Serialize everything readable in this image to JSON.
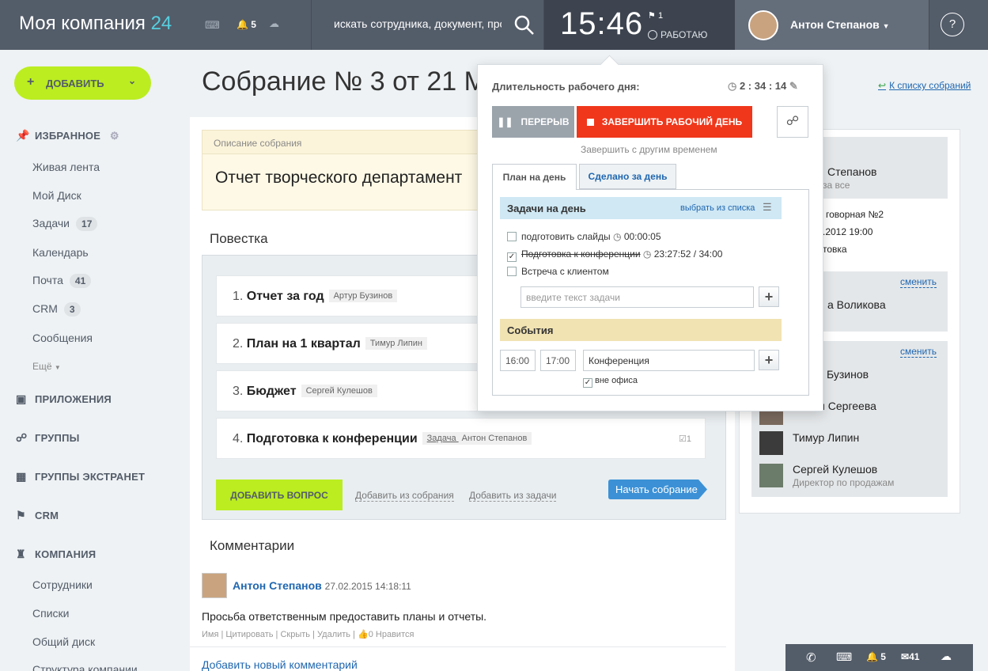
{
  "header": {
    "logo_text": "Моя компания",
    "logo_num": "24",
    "notif_count": "5",
    "search_placeholder": "искать сотрудника, документ, прочее...",
    "clock": "15:46",
    "flag_count": "1",
    "status": "РАБОТАЮ",
    "user_name": "Антон Степанов",
    "help": "?"
  },
  "left": {
    "add_label": "ДОБАВИТЬ",
    "favorites": "ИЗБРАННОЕ",
    "items": [
      {
        "label": "Живая лента",
        "count": ""
      },
      {
        "label": "Мой Диск",
        "count": ""
      },
      {
        "label": "Задачи",
        "count": "17"
      },
      {
        "label": "Календарь",
        "count": ""
      },
      {
        "label": "Почта",
        "count": "41"
      },
      {
        "label": "CRM",
        "count": "3"
      },
      {
        "label": "Сообщения",
        "count": ""
      }
    ],
    "more": "Ещё",
    "sections": [
      "ПРИЛОЖЕНИЯ",
      "ГРУППЫ",
      "ГРУППЫ ЭКСТРАНЕТ",
      "CRM",
      "КОМПАНИЯ"
    ],
    "company_items": [
      "Сотрудники",
      "Списки",
      "Общий диск",
      "Структура компании"
    ]
  },
  "main": {
    "title": "Собрание № 3 от 21 М",
    "back_link": "К списку собраний",
    "desc_label": "Описание собрания",
    "desc_text": "Отчет творческого департамент",
    "agenda_title": "Повестка",
    "agenda": [
      {
        "num": "1.",
        "title": "Отчет за год",
        "tag1": "",
        "tag2": "Артур Бузинов"
      },
      {
        "num": "2.",
        "title": "План на 1 квартал",
        "tag1": "",
        "tag2": "Тимур Липин"
      },
      {
        "num": "3.",
        "title": "Бюджет",
        "tag1": "",
        "tag2": "Сергей Кулешов"
      },
      {
        "num": "4.",
        "title": "Подготовка к конференции",
        "tag1": "Задача",
        "tag2": "Антон Степанов"
      }
    ],
    "task_count": "1",
    "add_question": "ДОБАВИТЬ ВОПРОС",
    "add_from_meeting": "Добавить из собрания",
    "add_from_task": "Добавить из задачи",
    "start_meeting": "Начать собрание",
    "comments_title": "Комментарии",
    "comment_author": "Антон Степанов",
    "comment_date": "27.02.2015 14:18:11",
    "comment_text": "Просьба ответственным предоставить планы и отчеты.",
    "comment_actions": [
      "Имя",
      "Цитировать",
      "Скрыть",
      "Удалить"
    ],
    "like_count": "0",
    "like_label": "Нравится",
    "add_comment": "Добавить новый комментарий"
  },
  "right": {
    "owner": "Степанов",
    "owner_sub": "за все",
    "place": "говорная №2",
    "date": ".2012 19:00",
    "type": "товка",
    "change1": "сменить",
    "secretary": "а Воликова",
    "change2": "сменить",
    "members": [
      {
        "name": "Бузинов",
        "sub": ""
      },
      {
        "name": "ья Сергеева",
        "sub": ""
      },
      {
        "name": "Тимур Липин",
        "sub": ""
      },
      {
        "name": "Сергей Кулешов",
        "sub": "Директор по продажам"
      }
    ]
  },
  "popup": {
    "duration_label": "Длительность рабочего дня:",
    "duration": "2 : 34 : 14",
    "pause": "ПЕРЕРЫВ",
    "finish": "ЗАВЕРШИТЬ РАБОЧИЙ ДЕНЬ",
    "finish_other": "Завершить с другим временем",
    "tab_plan": "План на день",
    "tab_done": "Сделано за день",
    "tasks_header": "Задачи на день",
    "choose_list": "выбрать из списка",
    "tasks": [
      {
        "label": "подготовить слайды",
        "time": "00:00:05",
        "checked": false
      },
      {
        "label": "Подготовка к конференции",
        "time": "23:27:52 / 34:00",
        "checked": true
      },
      {
        "label": "Встреча с клиентом",
        "time": "",
        "checked": false
      }
    ],
    "task_placeholder": "введите текст задачи",
    "events_header": "События",
    "event_from": "16:00",
    "event_to": "17:00",
    "event_name": "Конференция",
    "out_of_office": "вне офиса"
  },
  "bottombar": {
    "notif": "5",
    "mail": "41"
  }
}
